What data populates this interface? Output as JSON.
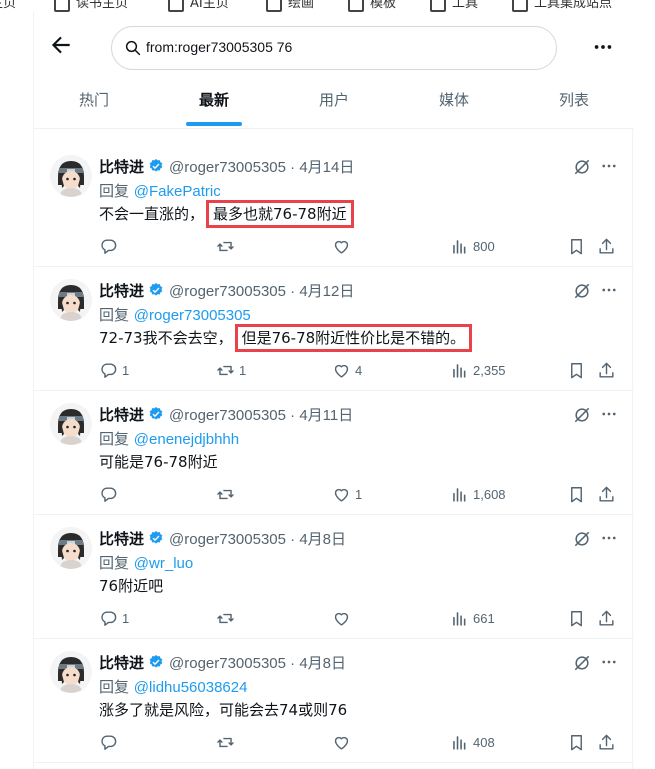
{
  "bookmarks": [
    "主页",
    "读书主页",
    "AI主页",
    "绘画",
    "模板",
    "工具",
    "工具集成站点"
  ],
  "header": {
    "search_value": "from:roger73005305 76",
    "tabs": [
      {
        "label": "热门"
      },
      {
        "label": "最新"
      },
      {
        "label": "用户"
      },
      {
        "label": "媒体"
      },
      {
        "label": "列表"
      }
    ],
    "active_tab": "最新"
  },
  "tweets": [
    {
      "name": "比特进",
      "handle": "@roger73005305 · 4月14日",
      "reply_prefix": "回复",
      "reply_to": "@FakePatric",
      "text_plain": "不会一直涨的，",
      "text_highlight": "最多也就76-78附近",
      "replies": "",
      "retweets": "",
      "likes": "",
      "views": "800"
    },
    {
      "name": "比特进",
      "handle": "@roger73005305 · 4月12日",
      "reply_prefix": "回复",
      "reply_to": "@roger73005305",
      "text_plain": "72-73我不会去空，",
      "text_highlight": "但是76-78附近性价比是不错的。",
      "replies": "1",
      "retweets": "1",
      "likes": "4",
      "views": "2,355"
    },
    {
      "name": "比特进",
      "handle": "@roger73005305 · 4月11日",
      "reply_prefix": "回复",
      "reply_to": "@enenejdjbhhh",
      "text_plain": "可能是76-78附近",
      "text_highlight": "",
      "replies": "",
      "retweets": "",
      "likes": "1",
      "views": "1,608"
    },
    {
      "name": "比特进",
      "handle": "@roger73005305 · 4月8日",
      "reply_prefix": "回复",
      "reply_to": "@wr_luo",
      "text_plain": "76附近吧",
      "text_highlight": "",
      "replies": "1",
      "retweets": "",
      "likes": "",
      "views": "661"
    },
    {
      "name": "比特进",
      "handle": "@roger73005305 · 4月8日",
      "reply_prefix": "回复",
      "reply_to": "@lidhu56038624",
      "text_plain": "涨多了就是风险，可能会去74或则76",
      "text_highlight": "",
      "replies": "",
      "retweets": "",
      "likes": "",
      "views": "408"
    }
  ],
  "colors": {
    "accent": "#1d9bf0",
    "highlight_box": "#e8434a",
    "muted_text": "#536471"
  },
  "icons": [
    "back-arrow-icon",
    "search-icon",
    "more-icon",
    "verified-badge-icon",
    "grok-icon",
    "reply-icon",
    "retweet-icon",
    "like-icon",
    "views-icon",
    "bookmark-icon",
    "share-icon"
  ]
}
